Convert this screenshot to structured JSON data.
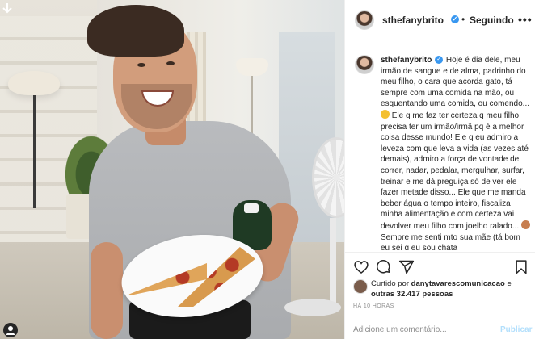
{
  "post": {
    "username": "sthefanybrito",
    "separator": "•",
    "follow_state": "Seguindo",
    "more_label": "•••"
  },
  "caption": {
    "username": "sthefanybrito",
    "text_part1": " Hoje é dia dele, meu irmão de sangue e de alma, padrinho do meu filho, o cara que acorda gato, tá sempre com uma comida na mão, ou esquentando uma comida, ou comendo... ",
    "text_part2": " Ele q me faz ter certeza q meu filho precisa ter um irmão/irmã pq é a melhor coisa desse mundo! Ele q eu admiro a leveza com que leva a vida (as vezes até demais), admiro a força de vontade de correr, nadar, pedalar, mergulhar, surfar, treinar e me dá preguiça só de ver ele fazer metade disso... Ele que me manda beber água o tempo inteiro, fiscaliza minha alimentação e com certeza vai devolver meu filho com joelho ralado... ",
    "text_part3": " Sempre me senti mto sua mãe (tá bom eu sei q eu sou chata"
  },
  "likes": {
    "prefix": "Curtido por ",
    "user": "danytavarescomunicacao",
    "middle": " e ",
    "others": "outras 32.417 pessoas"
  },
  "timestamp": "HÁ 10 HORAS",
  "comment": {
    "placeholder": "Adicione um comentário...",
    "publish_label": "Publicar"
  },
  "icons": {
    "photo_top": "arrow-down-icon",
    "photo_bottom": "user-tag-icon",
    "like": "heart-icon",
    "comment": "comment-icon",
    "share": "share-icon",
    "save": "bookmark-icon"
  },
  "colors": {
    "verified": "#3897f0",
    "publish_disabled": "#b2dffc",
    "text": "#262626",
    "muted": "#8e8e8e"
  }
}
